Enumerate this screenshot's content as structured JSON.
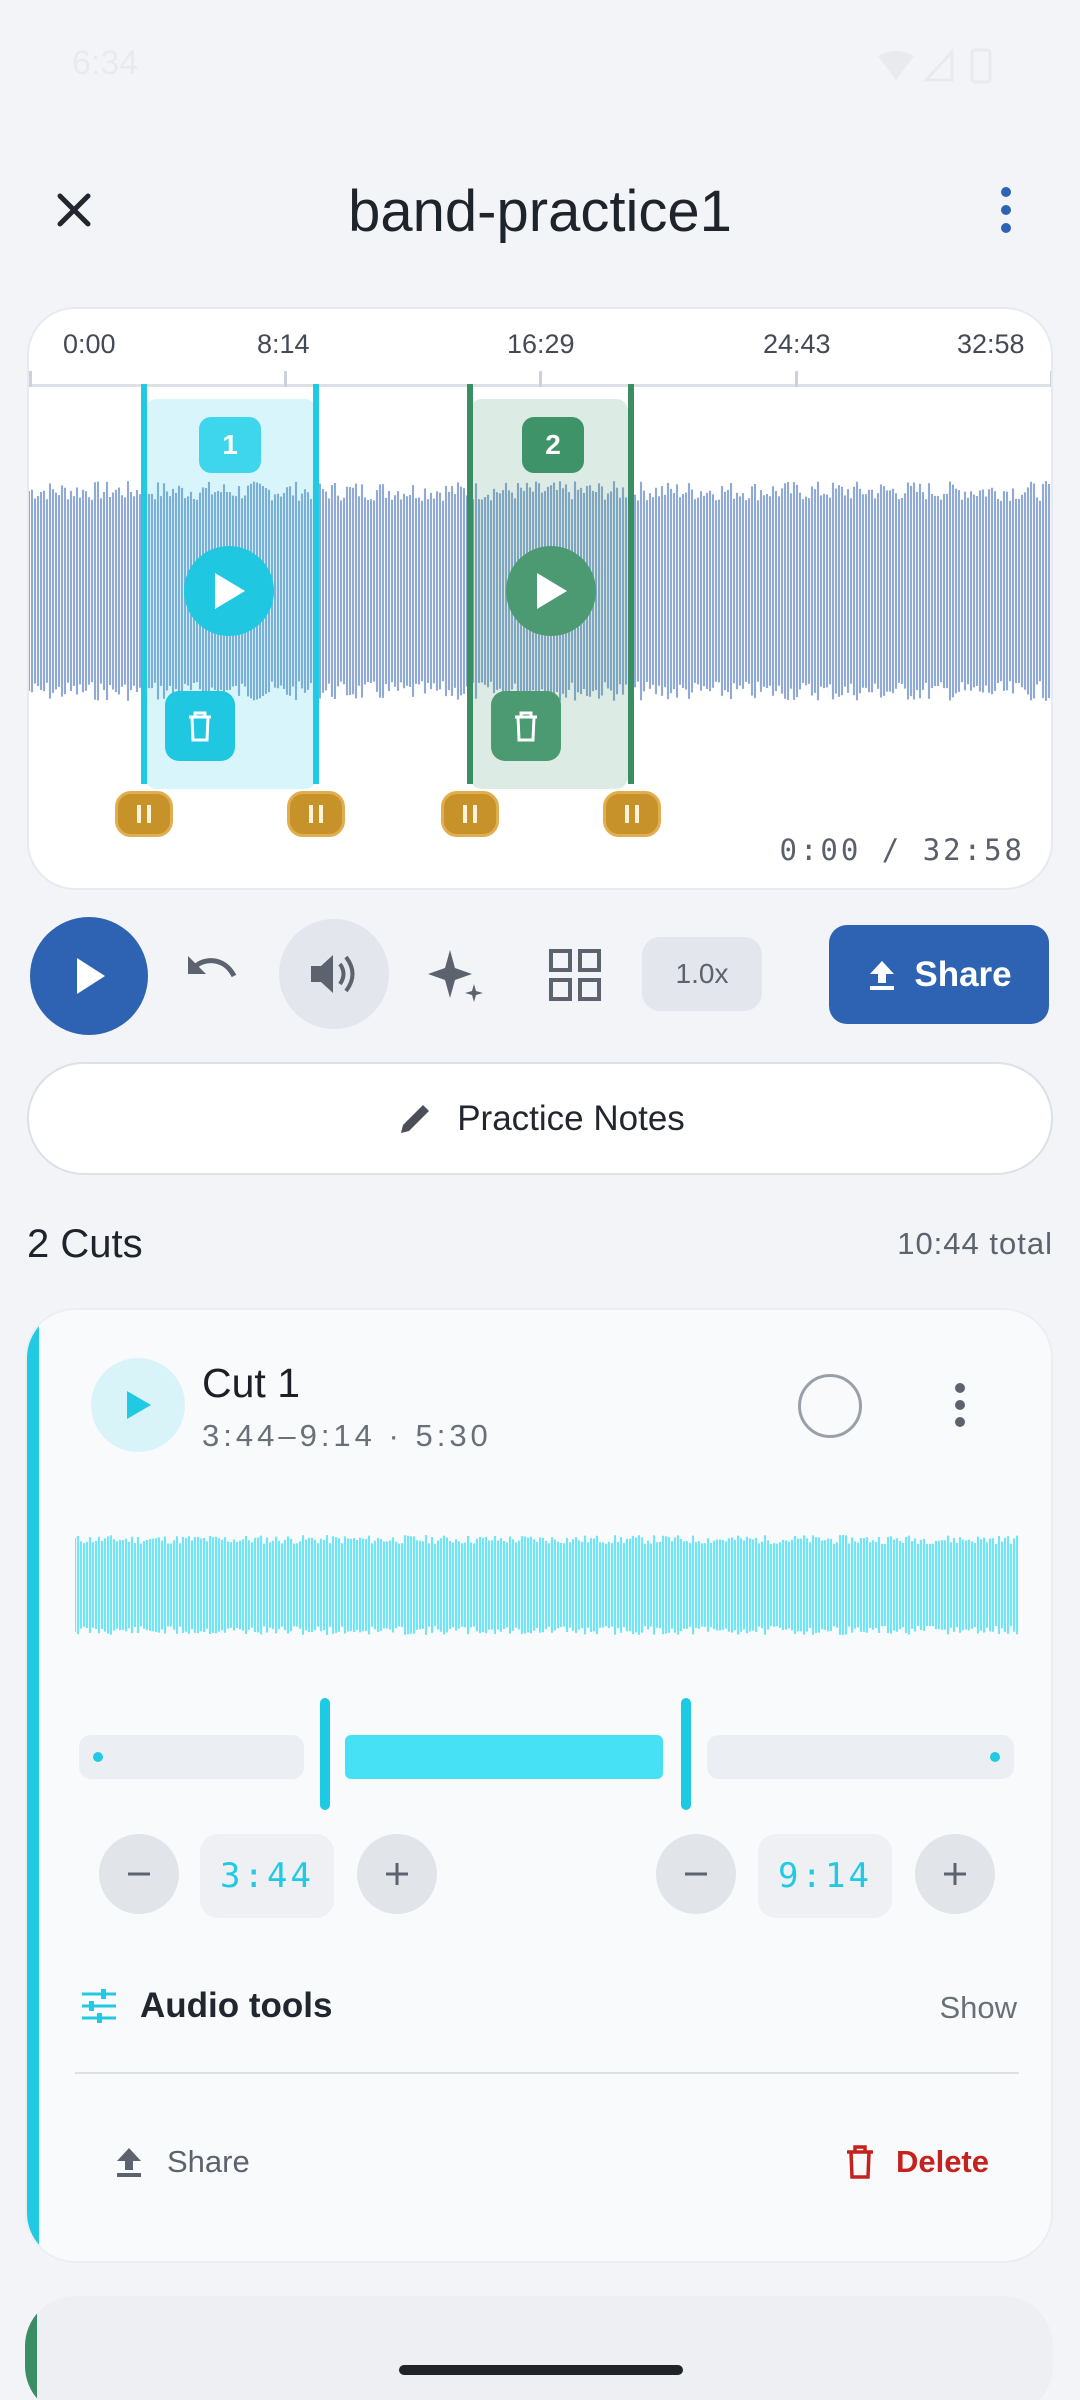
{
  "status_bar": {
    "time": "6:34"
  },
  "header": {
    "title": "band-practice1",
    "close_icon": "close-icon",
    "more_icon": "more-vert-icon"
  },
  "waveform": {
    "ruler_labels": [
      "0:00",
      "8:14",
      "16:29",
      "24:43",
      "32:58"
    ],
    "timecode": "0:00 / 32:58",
    "regions": [
      {
        "number": "1",
        "color": "#22C9E3",
        "start": "3:44",
        "end": "9:14"
      },
      {
        "number": "2",
        "color": "#3B8E63"
      }
    ]
  },
  "controls": {
    "speed": "1.0x",
    "share_label": "Share",
    "icons": [
      "play-icon",
      "undo-icon",
      "volume-icon",
      "sparkle-icon",
      "grid-icon",
      "upload-icon"
    ]
  },
  "notes": {
    "label": "Practice Notes"
  },
  "cuts": {
    "title": "2 Cuts",
    "total": "10:44 total",
    "items": [
      {
        "name": "Cut 1",
        "range": "3:44–9:14 · 5:30",
        "start_time": "3:44",
        "end_time": "9:14",
        "tools_label": "Audio tools",
        "tools_action": "Show",
        "share_label": "Share",
        "delete_label": "Delete",
        "accent": "#22C9E3"
      }
    ]
  },
  "colors": {
    "primary": "#2E63B3",
    "cut1": "#22C9E3",
    "cut2": "#3B8E63",
    "handle": "#C8922B",
    "danger": "#C5221F"
  }
}
